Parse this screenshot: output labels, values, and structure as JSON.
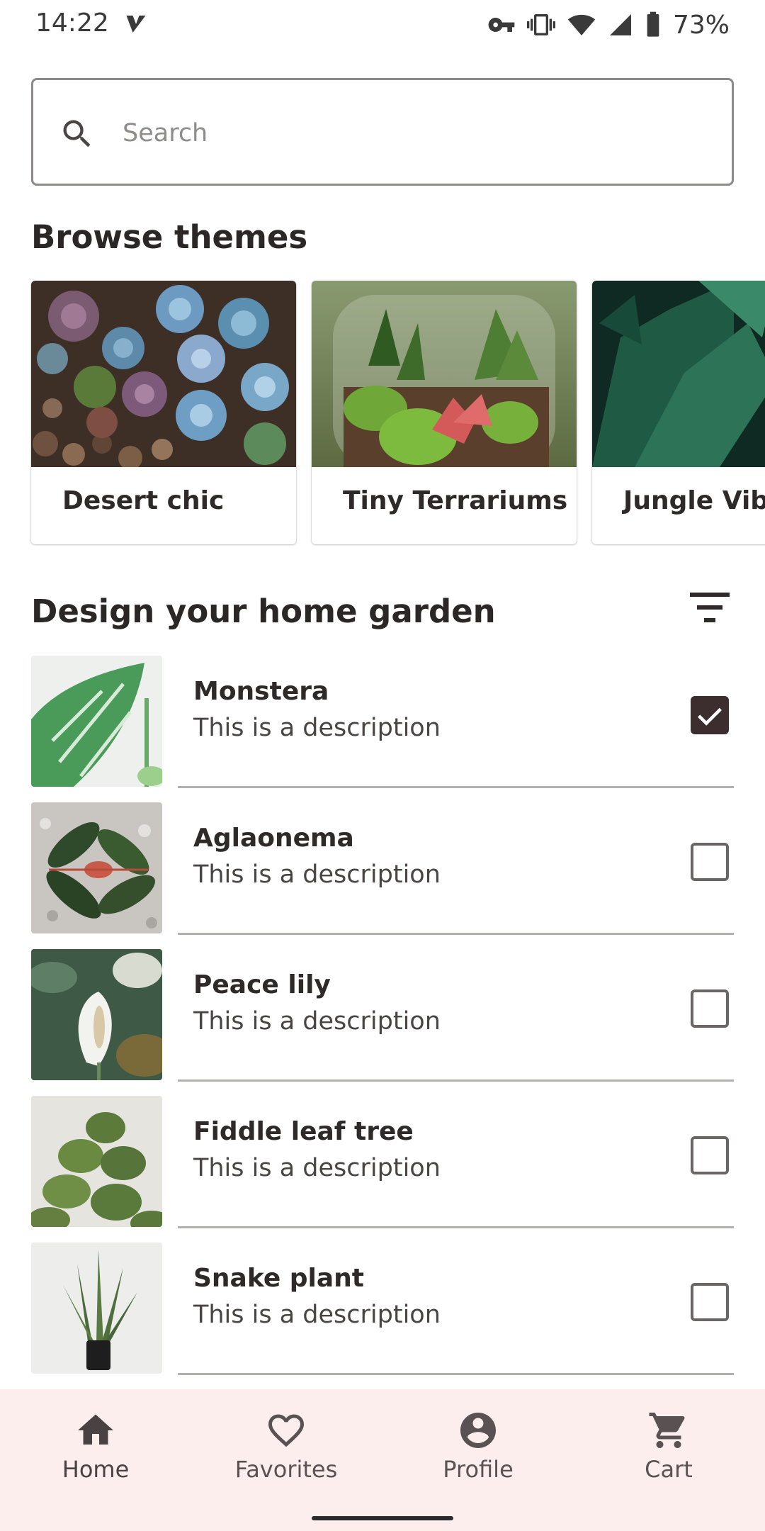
{
  "status_bar": {
    "time": "14:22",
    "battery": "73%",
    "icons": [
      "app-notification-icon",
      "vpn-key-icon",
      "vibrate-icon",
      "wifi-icon",
      "cell-signal-icon",
      "battery-icon"
    ]
  },
  "search": {
    "placeholder": "Search",
    "value": "",
    "icon": "search-icon"
  },
  "browse": {
    "title": "Browse themes",
    "themes": [
      {
        "label": "Desert chic"
      },
      {
        "label": "Tiny Terrariums"
      },
      {
        "label": "Jungle Vibes"
      }
    ]
  },
  "design": {
    "title": "Design your home garden",
    "filter_icon": "filter-list-icon",
    "plants": [
      {
        "name": "Monstera",
        "description": "This is a description",
        "checked": true
      },
      {
        "name": "Aglaonema",
        "description": "This is a description",
        "checked": false
      },
      {
        "name": "Peace lily",
        "description": "This is a description",
        "checked": false
      },
      {
        "name": "Fiddle leaf tree",
        "description": "This is a description",
        "checked": false
      },
      {
        "name": "Snake plant",
        "description": "This is a description",
        "checked": false
      }
    ]
  },
  "nav": {
    "items": [
      {
        "label": "Home",
        "icon": "home-icon",
        "selected": true
      },
      {
        "label": "Favorites",
        "icon": "heart-icon",
        "selected": false
      },
      {
        "label": "Profile",
        "icon": "account-circle-icon",
        "selected": false
      },
      {
        "label": "Cart",
        "icon": "cart-icon",
        "selected": false
      }
    ]
  },
  "colors": {
    "nav_background": "#fdeeee",
    "checkbox_checked": "#3c2e2e",
    "text_primary": "#2f2a2a"
  }
}
